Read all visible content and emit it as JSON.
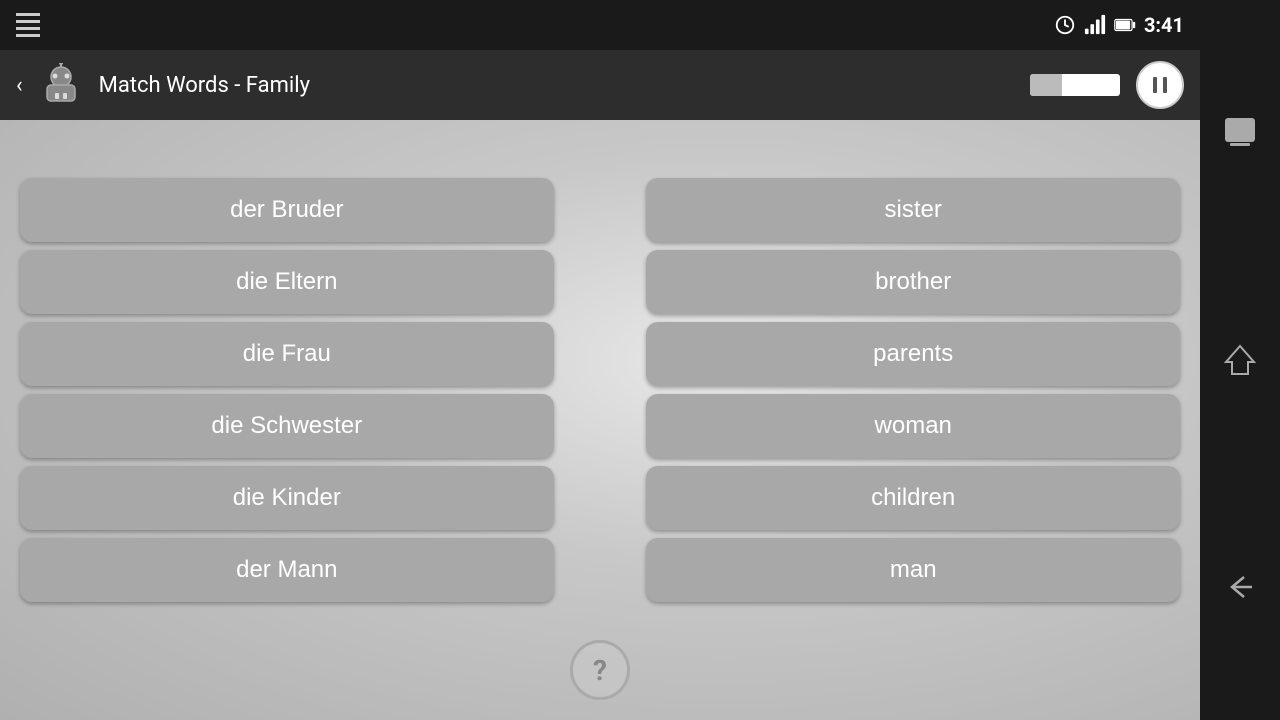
{
  "statusBar": {
    "time": "3:41"
  },
  "actionBar": {
    "title": "Match Words - Family",
    "pauseLabel": "Pause"
  },
  "leftColumn": {
    "words": [
      "der Bruder",
      "die Eltern",
      "die Frau",
      "die Schwester",
      "die Kinder",
      "der Mann"
    ]
  },
  "rightColumn": {
    "words": [
      "sister",
      "brother",
      "parents",
      "woman",
      "children",
      "man"
    ]
  },
  "helpButton": {
    "label": "?"
  },
  "nav": {
    "recentApps": "⬜",
    "home": "⌂",
    "back": "←"
  }
}
